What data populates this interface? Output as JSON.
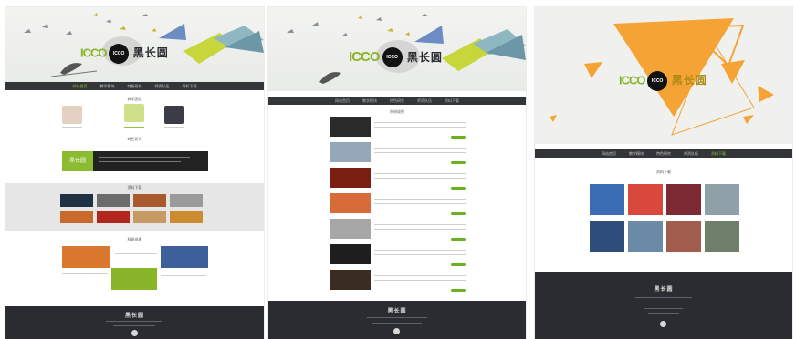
{
  "site": {
    "logo_letters": "ICCO",
    "logo_chinese": "黑长圆",
    "nav_items": [
      "网站首页",
      "教学模块",
      "特色研究",
      "师资队伍",
      "资料下载"
    ]
  },
  "panels": [
    {
      "sections": {
        "teachers": "教学团队",
        "intro": "特色研究",
        "downloads": "资料下载",
        "research": "科研成果"
      },
      "intro_banner_text": "黑长圆"
    },
    {
      "section_title": "科研成果",
      "list_count_label": "7"
    },
    {
      "section_title": "资料下载"
    }
  ],
  "colors": {
    "accent_green": "#8fc63b",
    "accent_orange": "#f4a334",
    "nav_dark": "#333538",
    "footer_dark": "#2a2c31"
  }
}
